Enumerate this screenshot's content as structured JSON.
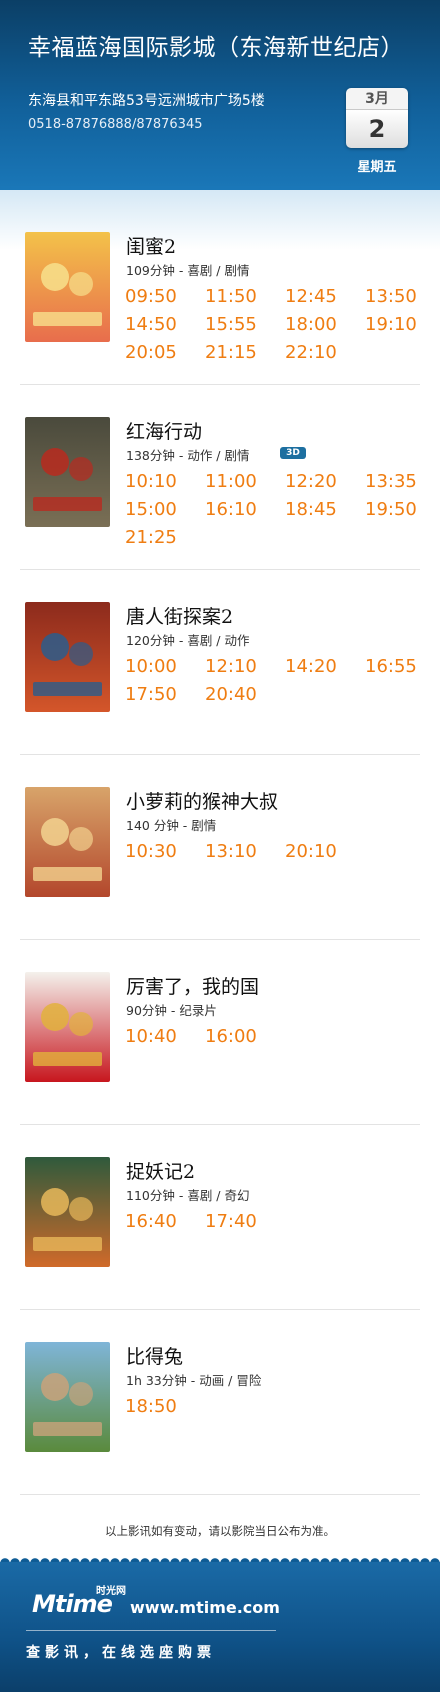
{
  "cinema": {
    "name": "幸福蓝海国际影城（东海新世纪店）",
    "address": "东海县和平东路53号远洲城市广场5楼",
    "phone": "0518-87876888/87876345"
  },
  "date": {
    "month": "3月",
    "day": "2",
    "weekday": "星期五"
  },
  "movies": [
    {
      "title": "闺蜜2",
      "meta": "109分钟 - 喜剧 / 剧情",
      "badge": "",
      "times": [
        "09:50",
        "11:50",
        "12:45",
        "13:50",
        "14:50",
        "15:55",
        "18:00",
        "19:10",
        "20:05",
        "21:15",
        "22:10"
      ],
      "poster_colors": [
        "#f3c24a",
        "#e86d4c",
        "#f7e08c"
      ]
    },
    {
      "title": "红海行动",
      "meta": "138分钟 - 动作 / 剧情",
      "badge": "3D",
      "times": [
        "10:10",
        "11:00",
        "12:20",
        "13:35",
        "15:00",
        "16:10",
        "18:45",
        "19:50",
        "21:25"
      ],
      "poster_colors": [
        "#4a4a3c",
        "#7a6f55",
        "#b92a1f"
      ]
    },
    {
      "title": "唐人街探案2",
      "meta": "120分钟 - 喜剧 / 动作",
      "badge": "",
      "times": [
        "10:00",
        "12:10",
        "14:20",
        "16:55",
        "17:50",
        "20:40"
      ],
      "poster_colors": [
        "#8c2a1c",
        "#d4562a",
        "#2b5d8c"
      ]
    },
    {
      "title": "小萝莉的猴神大叔",
      "meta": "140 分钟 - 剧情",
      "badge": "",
      "times": [
        "10:30",
        "13:10",
        "20:10"
      ],
      "poster_colors": [
        "#d8a46a",
        "#b3472c",
        "#f2d28f"
      ]
    },
    {
      "title": "厉害了，我的国",
      "meta": "90分钟 - 纪录片",
      "badge": "",
      "times": [
        "10:40",
        "16:00"
      ],
      "poster_colors": [
        "#f4f1ec",
        "#c7161e",
        "#e2b23c"
      ]
    },
    {
      "title": "捉妖记2",
      "meta": "110分钟 - 喜剧 / 奇幻",
      "badge": "",
      "times": [
        "16:40",
        "17:40"
      ],
      "poster_colors": [
        "#2f5a3c",
        "#d06a2a",
        "#e8b85a"
      ]
    },
    {
      "title": "比得兔",
      "meta": "1h 33分钟 - 动画 / 冒险",
      "badge": "",
      "times": [
        "18:50"
      ],
      "poster_colors": [
        "#7fb5d8",
        "#5a8a3c",
        "#c9a27a"
      ]
    }
  ],
  "notice": "以上影讯如有变动，请以影院当日公布为准。",
  "footer": {
    "logo_text": "Mtime",
    "logo_sub": "时光网",
    "url": "www.mtime.com",
    "slogan": "查影讯，在线选座购票"
  }
}
